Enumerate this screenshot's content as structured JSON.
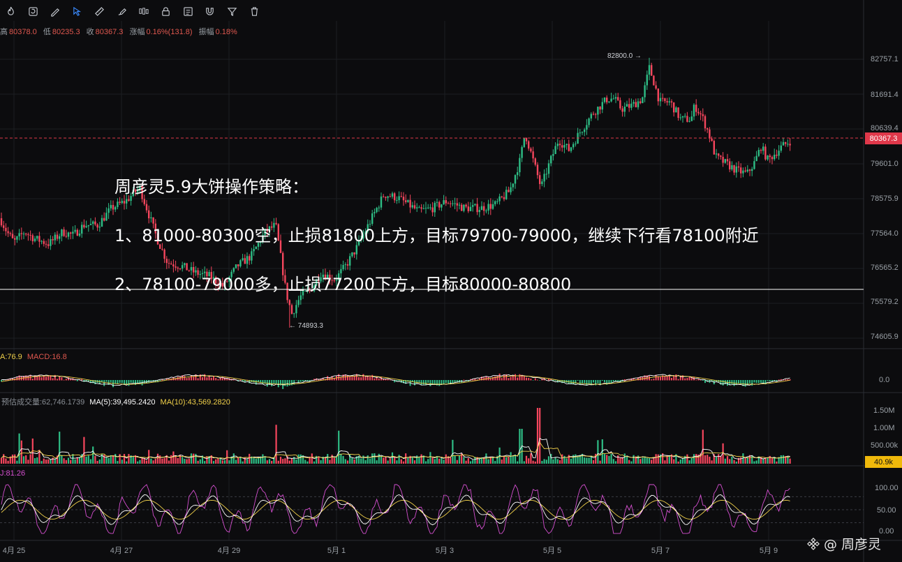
{
  "toolbar": {
    "icons": [
      "fire-icon",
      "rotate-icon",
      "pencil-line-icon",
      "selection-icon",
      "ruler-icon",
      "brush-icon",
      "candlestick-icon",
      "lock-icon",
      "note-icon",
      "magnet-icon",
      "filter-icon",
      "trash-icon"
    ]
  },
  "ohlc": {
    "high_label": "高",
    "high": "80378.0",
    "low_label": "低",
    "low": "80235.3",
    "close_label": "收",
    "close": "80367.3",
    "change_label": "涨幅",
    "change": "0.16%(131.8)",
    "amplitude_label": "振幅",
    "amplitude": "0.18%"
  },
  "overlay_text": {
    "title": "周彦灵5.9大饼操作策略：",
    "line1": "1、81000-80300空，止损81800上方，目标79700-79000，继续下行看78100附近",
    "line2": "2、78100-79000多，止损77200下方，目标80000-80800"
  },
  "price_axis": [
    "82757.1",
    "81691.4",
    "80639.4",
    "79601.0",
    "78575.9",
    "77564.0",
    "76565.2",
    "75579.2",
    "74605.9"
  ],
  "current_price_tag": "80367.3",
  "high_marker": "82800.0 →",
  "low_marker": "← 74893.3",
  "macd": {
    "label_a": "A:76.9",
    "label_macd": "MACD:16.8",
    "axis": [
      "0.0"
    ]
  },
  "volume": {
    "label_est": "预估成交量:62,746.1739",
    "label_ma5": "MA(5):39,495.2420",
    "label_ma10": "MA(10):43,569.2820",
    "axis": [
      "1.50M",
      "1.00M",
      "500.00k"
    ],
    "current_tag": "40.9k"
  },
  "kdj": {
    "label_j": "J:81.26",
    "axis": [
      "100.00",
      "50.00",
      "0.00"
    ]
  },
  "x_axis": [
    "4月 25",
    "4月 27",
    "4月 29",
    "5月 1",
    "5月 3",
    "5月 5",
    "5月 7",
    "5月 9"
  ],
  "watermark": {
    "text": "@ 周彦灵",
    "icon": "binance-logo-icon"
  },
  "colors": {
    "up": "#2ebd85",
    "down": "#f6465d",
    "price_tag": "#e0384a",
    "volume_tag": "#f0b90b",
    "ma_yellow": "#f0d04a",
    "ma_white": "#ffffff",
    "kdj_pink": "#d54fd0"
  },
  "chart_data": {
    "type": "candlestick",
    "price_range": [
      74300,
      83200
    ],
    "anchor_closes": [
      [
        0,
        78100
      ],
      [
        10,
        77700
      ],
      [
        20,
        77400
      ],
      [
        35,
        77700
      ],
      [
        50,
        77500
      ],
      [
        70,
        77350
      ],
      [
        90,
        77700
      ],
      [
        105,
        77600
      ],
      [
        120,
        77900
      ],
      [
        140,
        77900
      ],
      [
        160,
        78400
      ],
      [
        180,
        78600
      ],
      [
        200,
        79000
      ],
      [
        210,
        78400
      ],
      [
        225,
        77500
      ],
      [
        240,
        76800
      ],
      [
        260,
        76700
      ],
      [
        280,
        76500
      ],
      [
        300,
        76400
      ],
      [
        320,
        76100
      ],
      [
        340,
        76700
      ],
      [
        360,
        77000
      ],
      [
        380,
        77700
      ],
      [
        395,
        77900
      ],
      [
        410,
        75900
      ],
      [
        418,
        75300
      ],
      [
        430,
        75800
      ],
      [
        445,
        76000
      ],
      [
        460,
        76500
      ],
      [
        470,
        76400
      ],
      [
        480,
        76300
      ],
      [
        495,
        76700
      ],
      [
        510,
        77200
      ],
      [
        530,
        78000
      ],
      [
        550,
        78800
      ],
      [
        570,
        78700
      ],
      [
        600,
        78300
      ],
      [
        620,
        78400
      ],
      [
        640,
        78600
      ],
      [
        665,
        78400
      ],
      [
        690,
        78400
      ],
      [
        710,
        78500
      ],
      [
        730,
        78900
      ],
      [
        745,
        79800
      ],
      [
        752,
        80600
      ],
      [
        765,
        79700
      ],
      [
        775,
        79000
      ],
      [
        785,
        79600
      ],
      [
        800,
        80400
      ],
      [
        815,
        80100
      ],
      [
        830,
        80600
      ],
      [
        850,
        81200
      ],
      [
        870,
        81600
      ],
      [
        880,
        81600
      ],
      [
        890,
        81300
      ],
      [
        905,
        81400
      ],
      [
        920,
        81600
      ],
      [
        930,
        82500
      ],
      [
        935,
        82200
      ],
      [
        945,
        81500
      ],
      [
        960,
        81500
      ],
      [
        975,
        81000
      ],
      [
        990,
        81000
      ],
      [
        995,
        81400
      ],
      [
        1005,
        81100
      ],
      [
        1015,
        80600
      ],
      [
        1025,
        79900
      ],
      [
        1040,
        79700
      ],
      [
        1055,
        79500
      ],
      [
        1070,
        79400
      ],
      [
        1080,
        79700
      ],
      [
        1090,
        80200
      ],
      [
        1100,
        79800
      ],
      [
        1110,
        80000
      ],
      [
        1120,
        80200
      ],
      [
        1132,
        80367
      ]
    ],
    "high": 82800.0,
    "low": 74893.3
  }
}
